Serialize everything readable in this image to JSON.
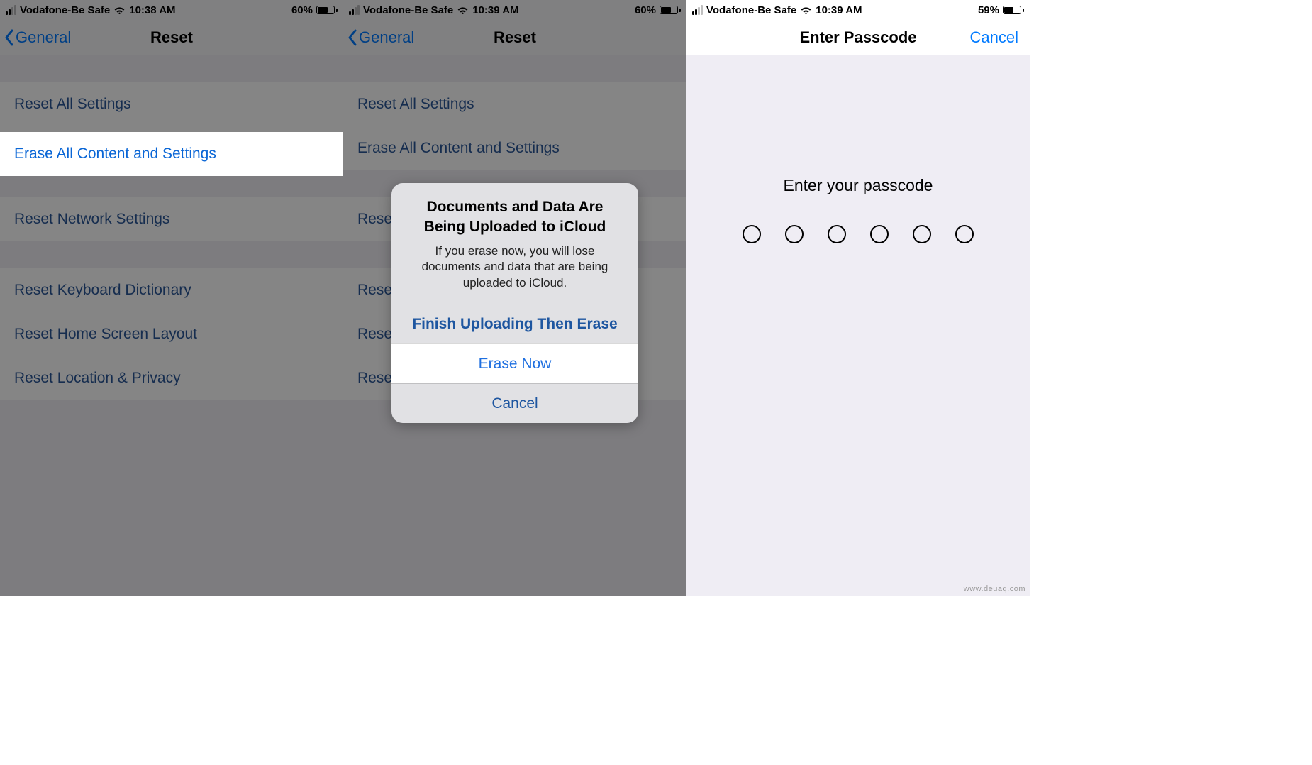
{
  "status": {
    "carrier": "Vodafone-Be Safe",
    "time_a": "10:38 AM",
    "time_b": "10:39 AM",
    "time_c": "10:39 AM",
    "battery_a": "60%",
    "battery_b": "60%",
    "battery_c": "59%"
  },
  "nav": {
    "back_label": "General",
    "reset_title": "Reset",
    "passcode_title": "Enter Passcode",
    "cancel_label": "Cancel"
  },
  "reset_items": {
    "reset_all": "Reset All Settings",
    "erase_all": "Erase All Content and Settings",
    "reset_network": "Reset Network Settings",
    "reset_keyboard": "Reset Keyboard Dictionary",
    "reset_home": "Reset Home Screen Layout",
    "reset_location": "Reset Location & Privacy",
    "reset_network_trunc": "Rese",
    "reset_keyboard_trunc": "Rese",
    "reset_home_trunc": "Rese",
    "reset_location_trunc": "Rese"
  },
  "alert": {
    "title": "Documents and Data Are Being Uploaded to iCloud",
    "message": "If you erase now, you will lose documents and data that are being uploaded to iCloud.",
    "finish": "Finish Uploading Then Erase",
    "erase_now": "Erase Now",
    "cancel": "Cancel"
  },
  "passcode": {
    "prompt": "Enter your passcode"
  },
  "watermark": "www.deuaq.com"
}
